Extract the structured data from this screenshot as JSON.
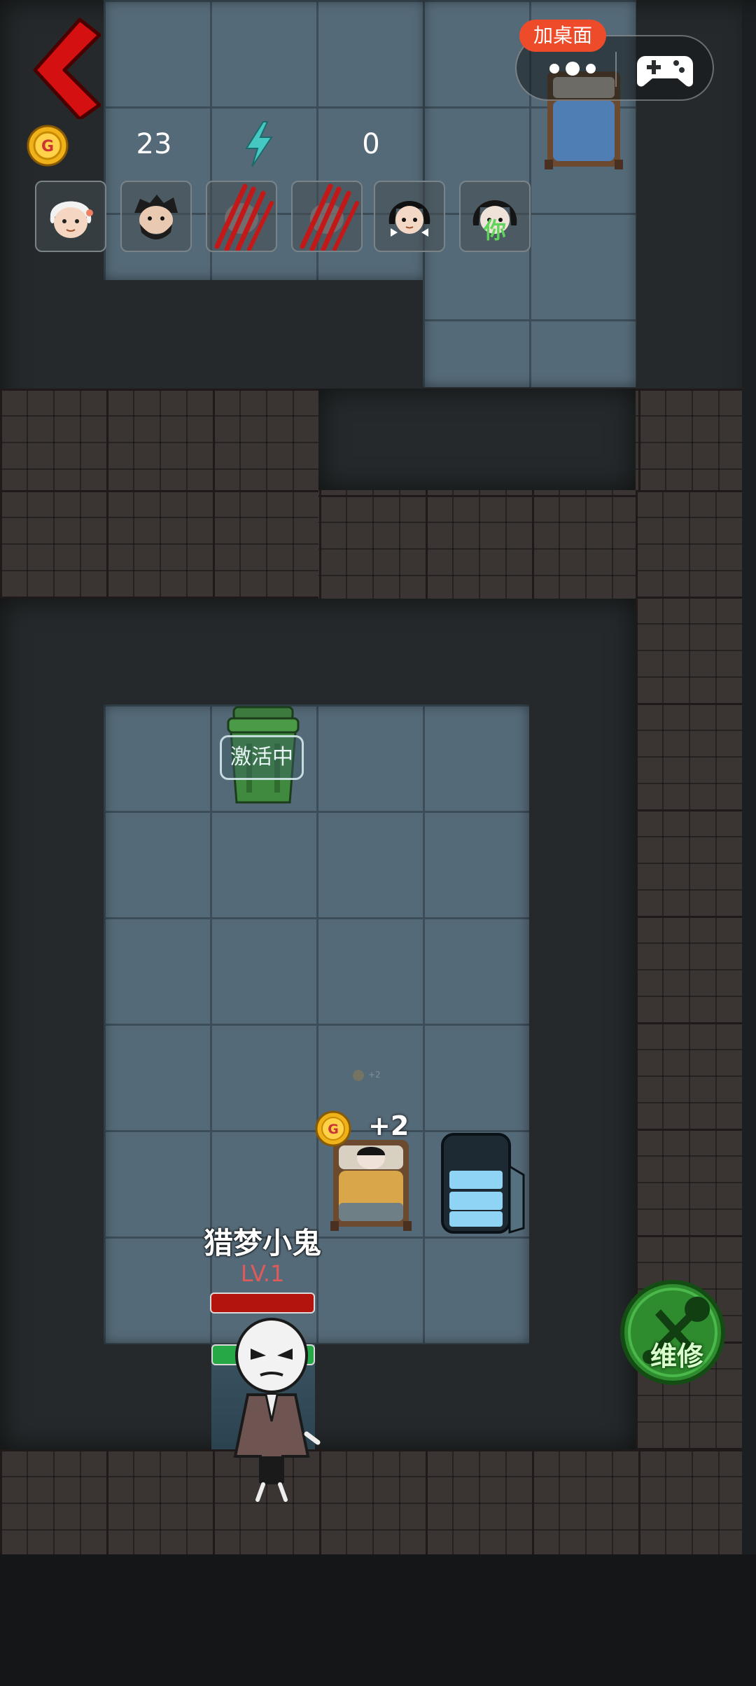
{
  "top_bar": {
    "add_desktop_label": "加桌面",
    "coins": "23",
    "energy": "0"
  },
  "roster": [
    {
      "name": "grandma-avatar",
      "state": "alive"
    },
    {
      "name": "bearded-man-avatar",
      "state": "alive"
    },
    {
      "name": "clawed-avatar-1",
      "state": "scratched"
    },
    {
      "name": "clawed-avatar-2",
      "state": "scratched"
    },
    {
      "name": "girl-avatar",
      "state": "alive"
    },
    {
      "name": "player-avatar",
      "state": "you",
      "tag": "你"
    }
  ],
  "room": {
    "trash_status": "激活中",
    "bed_income": "+2",
    "small_income": "+2"
  },
  "ghost": {
    "name": "猎梦小鬼",
    "level": "LV.1"
  },
  "actions": {
    "repair_label": "维修"
  },
  "colors": {
    "accent_red": "#d41010",
    "add_desktop_bg": "#ee4b2b",
    "hp_red": "#b3140e",
    "door_green": "#27a846",
    "repair_green": "#2e8b2e"
  }
}
